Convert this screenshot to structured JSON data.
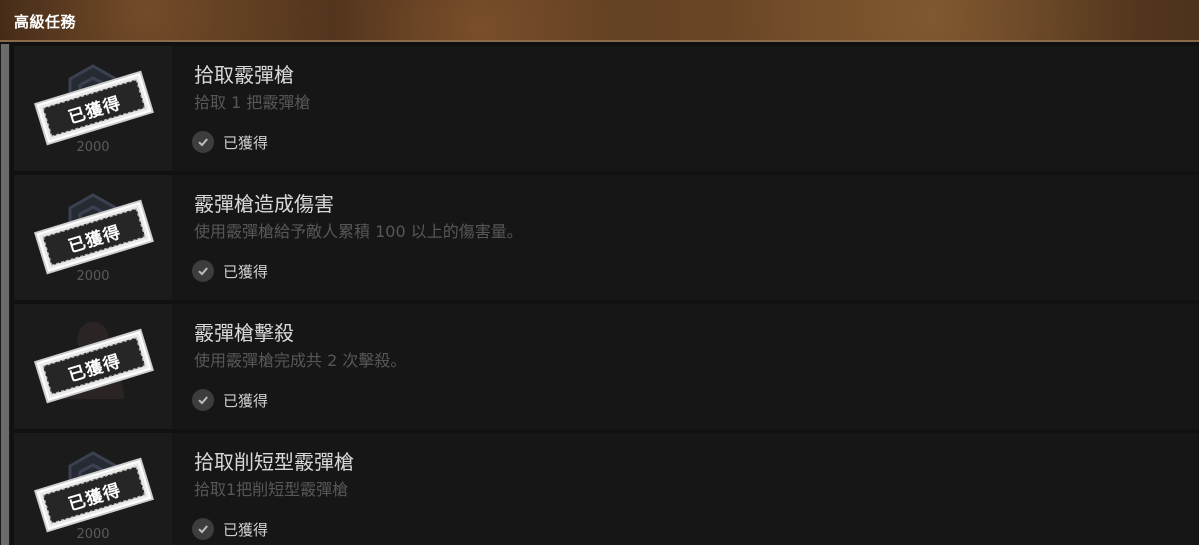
{
  "header": {
    "title": "高級任務"
  },
  "status_label": "已獲得",
  "stamp_label": "已獲得",
  "missions": [
    {
      "title": "拾取霰彈槍",
      "desc": "拾取 1 把霰彈槍",
      "points": "2000",
      "icon": "badge-hexagon-icon"
    },
    {
      "title": "霰彈槍造成傷害",
      "desc": "使用霰彈槍給予敵人累積 100 以上的傷害量。",
      "points": "2000",
      "icon": "badge-hexagon-icon"
    },
    {
      "title": "霰彈槍擊殺",
      "desc": "使用霰彈槍完成共 2 次擊殺。",
      "points": "",
      "icon": "character-portrait-icon"
    },
    {
      "title": "拾取削短型霰彈槍",
      "desc": "拾取1把削短型霰彈槍",
      "points": "2000",
      "icon": "badge-hexagon-icon"
    }
  ]
}
